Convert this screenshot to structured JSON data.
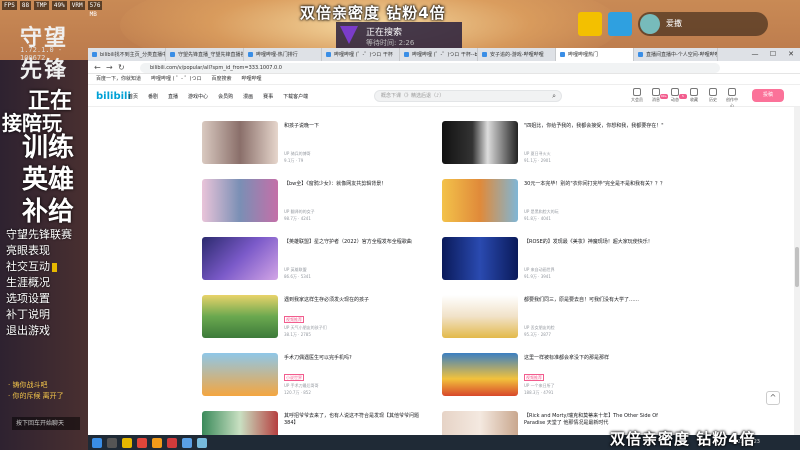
{
  "game": {
    "logo": "守望先锋",
    "version": "1.72.1.0 - 100672",
    "top_stats": [
      "FPS",
      "88",
      "TMP",
      "49%",
      "VRM",
      "576 MB"
    ],
    "promo_lines": [
      "正在",
      "训练",
      "英雄",
      "补给"
    ],
    "promo_extra": "接陪玩",
    "menu": [
      "守望先锋联赛",
      "亮眼表现",
      "社交互动",
      "生涯概况",
      "选项设置",
      "补丁说明",
      "退出游戏"
    ],
    "notice": [
      "· 铸你战斗吧",
      "· 你的斥候 离开了"
    ],
    "chat_button": "按下回车开始聊天"
  },
  "overlay": {
    "top_text": "双倍亲密度  钻粉4倍",
    "bottom_text": "双倍亲密度  钻粉4倍"
  },
  "search_status": {
    "status": "正在搜索",
    "elapsed": "等待时间: 2:26"
  },
  "stream": {
    "user": "爱撒"
  },
  "browser": {
    "tabs": [
      "bilibili找不到主页_分类直播中心",
      "守望先锋直播_守望先锋直播视频",
      "哔哩哔哩-热门排行",
      "哔哩哔哩 (゜-゜)つロ 干杯",
      "哔哩哔哩 (゜-゜)つロ 干杯--bilibili",
      "安子追的-游戏-哔哩哔哩",
      "哔哩哔哩热门",
      "直播间直播中-个人空间-哔哩哔哩"
    ],
    "url": "bilibili.com/v/popular/all?spm_id_from=333.1007.0.0",
    "bookmarks": [
      "百度一下，你就知道",
      "哔哩哔哩 ( ゜- ゜)つロ",
      "百度搜索",
      "哔哩哔哩"
    ],
    "win_controls": [
      "—",
      "☐",
      "✕"
    ]
  },
  "bili": {
    "logo": "bilibili",
    "nav": [
      "首页",
      "番剧",
      "直播",
      "游戏中心",
      "会员购",
      "漫画",
      "赛事",
      "下载客户端"
    ],
    "search_placeholder": "概念下课（》精选后退（♪）",
    "search_icon": "⌕",
    "icons": [
      {
        "label": "大会员",
        "badge": ""
      },
      {
        "label": "消息",
        "badge": "99+"
      },
      {
        "label": "动态",
        "badge": "5"
      },
      {
        "label": "收藏",
        "badge": ""
      },
      {
        "label": "历史",
        "badge": ""
      },
      {
        "label": "创作中心",
        "badge": ""
      }
    ],
    "post_button": "投稿",
    "scroll_top": "^"
  },
  "videos": [
    {
      "title": "和孩子说晚一下",
      "up": "UP 骑兵的博哥",
      "stats": "9.1万  · 79",
      "tag": ""
    },
    {
      "title": "\"四姐比，你给予我的，我都会接受，你想和我，我都要存在！\"",
      "up": "UP 夏日寻火火",
      "stats": "91.1万  · 2901",
      "tag": ""
    },
    {
      "title": "【bw全】《窗鸦少女》：就像网友共剪辑背景！",
      "up": "UP 翻译的的女子",
      "stats": "98.7万  · 4241",
      "tag": ""
    },
    {
      "title": "30元一本完毕！别的\"衣你间打完毕\"完全是不是和我有关？？？",
      "up": "UP 是黑和脸大的玩",
      "stats": "91.8万  · 4041",
      "tag": ""
    },
    {
      "title": "【英雄联盟】星之守护者（2022）官方全程发布全程歌曲",
      "up": "UP 英雄联盟",
      "stats": "86.6万  · 5341",
      "tag": ""
    },
    {
      "title": "【ROSE的】发现最《美妆》神魔现场！超大家玩使快乐！",
      "up": "UP 来自动画世界",
      "stats": "91.9万  · 3941",
      "tag": ""
    },
    {
      "title": "遇到我家这样生存必须发火现在的孩子",
      "up": "UP 天气小朋友的孩子们",
      "stats": "38.1万  · 2785",
      "tag": "视频推荐"
    },
    {
      "title": "都要我们同三，原是要去自！可我们没有大学了……",
      "up": "UP 丢女朋友的脸",
      "stats": "95.3万  · 2877",
      "tag": ""
    },
    {
      "title": "手术刀偶遇医生可以完手机吗?",
      "up": "UP 手术刀最后哥哥",
      "stats": "120.7万  · 852",
      "tag": "小说世界"
    },
    {
      "title": "这里一样被标准都会拿没下的那是那样",
      "up": "UP 一个来日所了",
      "stats": "188.3万  · 4791",
      "tag": "视频推荐"
    },
    {
      "title": "其呼招爷爷去来了，也有人说这不符合是发现【其他爷爷问题384】",
      "up": "UP 小刀同学",
      "stats": "",
      "tag": ""
    },
    {
      "title": "【Rick and Morty/瑞克和莫蒂来十年】The Other Side Of Paradise 天堂了 他那情况是最新时代",
      "up": "UP 动画翻译",
      "stats": "",
      "tag": ""
    }
  ],
  "taskbar": {
    "clock": "2022/11/23"
  }
}
